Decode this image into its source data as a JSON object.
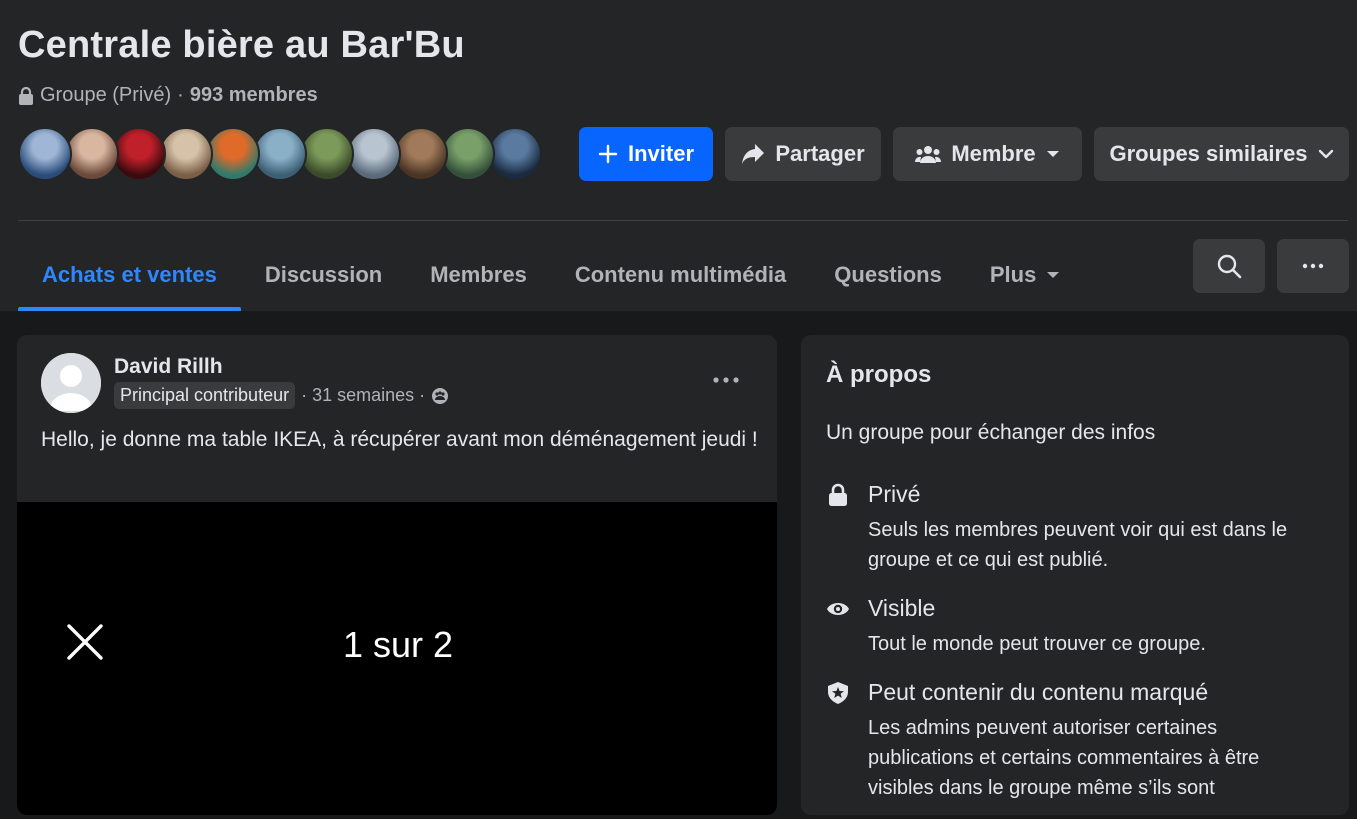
{
  "group": {
    "title": "Centrale bière au Bar'Bu",
    "privacy": "Groupe (Privé)",
    "separator": "·",
    "members": "993 membres"
  },
  "member_avatars": [
    {
      "color_a": "#9fb6d6",
      "color_b": "#2a4c7a"
    },
    {
      "color_a": "#d9b6a0",
      "color_b": "#6b4a3a"
    },
    {
      "color_a": "#c0202a",
      "color_b": "#3a0a0e"
    },
    {
      "color_a": "#d6c2a8",
      "color_b": "#7a5f46"
    },
    {
      "color_a": "#e06a2a",
      "color_b": "#2f7a6a"
    },
    {
      "color_a": "#8ab0c8",
      "color_b": "#3c5f74"
    },
    {
      "color_a": "#7c9a5a",
      "color_b": "#3a4a2a"
    },
    {
      "color_a": "#b8c4d0",
      "color_b": "#5a6a7a"
    },
    {
      "color_a": "#a07a5a",
      "color_b": "#4a3424"
    },
    {
      "color_a": "#7aa06a",
      "color_b": "#34503a"
    },
    {
      "color_a": "#5a7aa0",
      "color_b": "#1a2a40"
    }
  ],
  "actions": {
    "invite": "Inviter",
    "share": "Partager",
    "member": "Membre",
    "similar": "Groupes similaires"
  },
  "tabs": [
    {
      "label": "Achats et ventes",
      "active": true
    },
    {
      "label": "Discussion",
      "active": false
    },
    {
      "label": "Membres",
      "active": false
    },
    {
      "label": "Contenu multimédia",
      "active": false
    },
    {
      "label": "Questions",
      "active": false
    },
    {
      "label": "Plus",
      "active": false
    }
  ],
  "post": {
    "author": "David Rillh",
    "badge": "Principal contributeur",
    "time": "· 31 semaines ·",
    "text": "Hello, je donne ma table IKEA, à récupérer avant mon déménagement jeudi !",
    "counter": "1 sur 2"
  },
  "about": {
    "title": "À propos",
    "description": "Un groupe pour échanger des infos",
    "items": [
      {
        "title": "Privé",
        "text": "Seuls les membres peuvent voir qui est dans le groupe et ce qui est publié.",
        "icon": "lock-icon"
      },
      {
        "title": "Visible",
        "text": "Tout le monde peut trouver ce groupe.",
        "icon": "eye-icon"
      },
      {
        "title": "Peut contenir du contenu marqué",
        "text": "Les admins peuvent autoriser certaines publications et certains commentaires à être visibles dans le groupe même s’ils sont",
        "icon": "shield-star-icon"
      }
    ]
  },
  "colors": {
    "accent": "#0866ff",
    "tab_active": "#2d88ff",
    "surface": "#242526",
    "background": "#18191a"
  }
}
